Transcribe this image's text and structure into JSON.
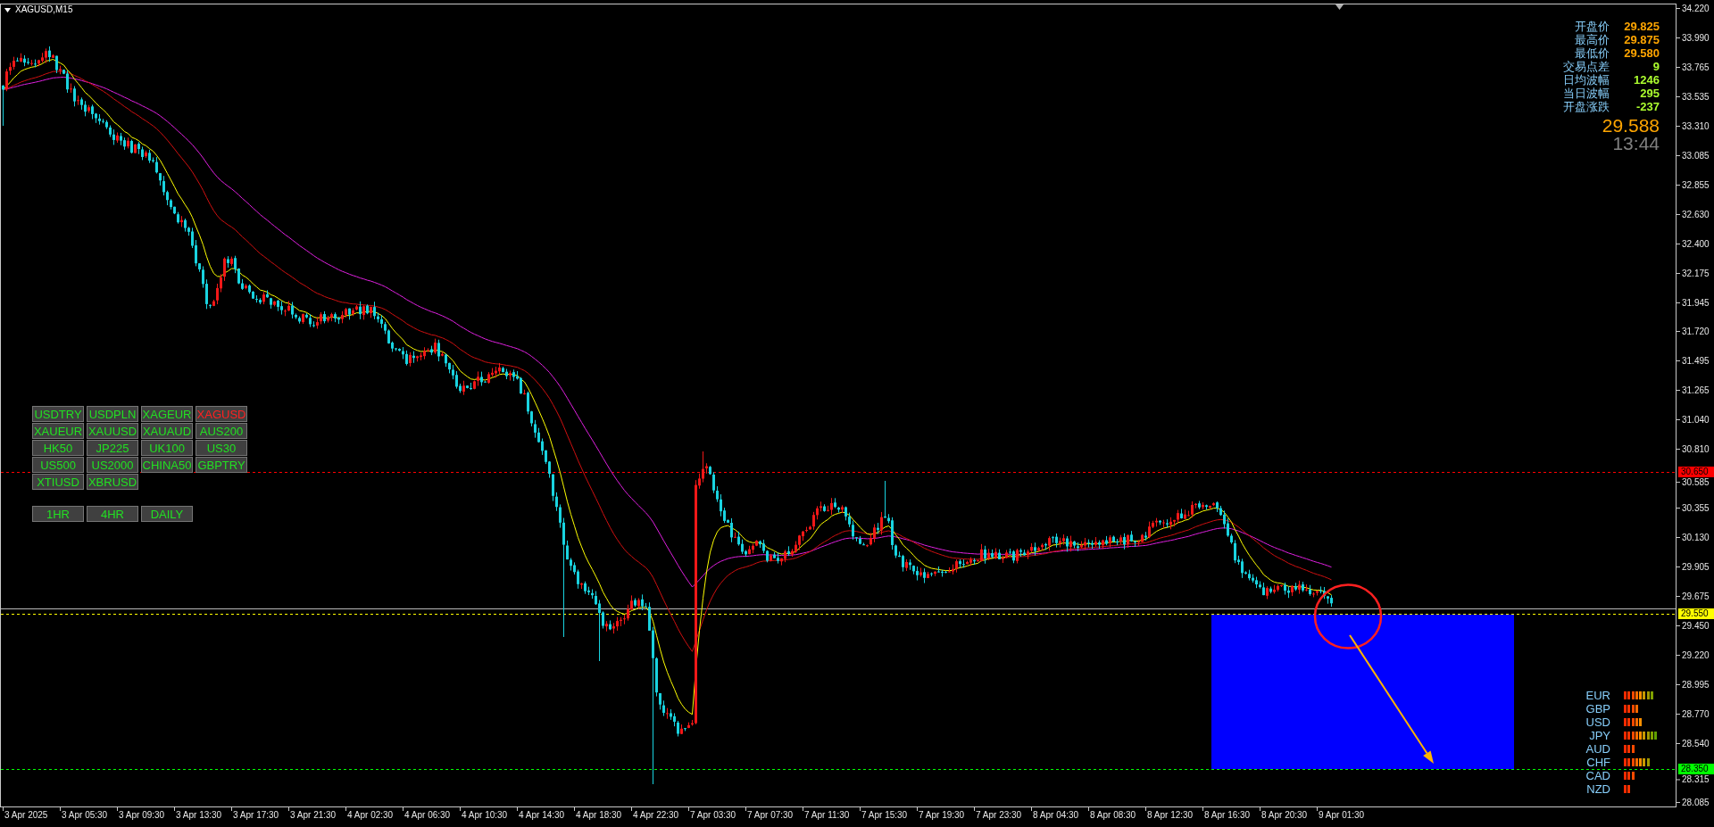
{
  "chart": {
    "title": "XAGUSD,M15"
  },
  "quote_panel": {
    "stats": [
      {
        "label": "开盘价",
        "value": "29.825",
        "color": "#ffa500"
      },
      {
        "label": "最高价",
        "value": "29.875",
        "color": "#ffa500"
      },
      {
        "label": "最低价",
        "value": "29.580",
        "color": "#ffa500"
      },
      {
        "label": "交易点差",
        "value": "9",
        "color": "#adff2f"
      },
      {
        "label": "日均波幅",
        "value": "1246",
        "color": "#adff2f"
      },
      {
        "label": "当日波幅",
        "value": "295",
        "color": "#adff2f"
      },
      {
        "label": "开盘涨跌",
        "value": "-237",
        "color": "#adff2f"
      }
    ],
    "price": "29.588",
    "countdown": "13:44"
  },
  "symbol_buttons": [
    {
      "label": "USDTRY",
      "selected": false
    },
    {
      "label": "USDPLN",
      "selected": false
    },
    {
      "label": "XAGEUR",
      "selected": false
    },
    {
      "label": "XAGUSD",
      "selected": true
    },
    {
      "label": "XAUEUR",
      "selected": false
    },
    {
      "label": "XAUUSD",
      "selected": false
    },
    {
      "label": "XAUAUD",
      "selected": false
    },
    {
      "label": "AUS200",
      "selected": false
    },
    {
      "label": "HK50",
      "selected": false
    },
    {
      "label": "JP225",
      "selected": false
    },
    {
      "label": "UK100",
      "selected": false
    },
    {
      "label": "US30",
      "selected": false
    },
    {
      "label": "US500",
      "selected": false
    },
    {
      "label": "US2000",
      "selected": false
    },
    {
      "label": "CHINA50",
      "selected": false
    },
    {
      "label": "GBPTRY",
      "selected": false
    },
    {
      "label": "XTIUSD",
      "selected": false
    },
    {
      "label": "XBRUSD",
      "selected": false
    }
  ],
  "timeframe_buttons": [
    {
      "label": "1HR",
      "selected": false
    },
    {
      "label": "4HR",
      "selected": false
    },
    {
      "label": "DAILY",
      "selected": false
    }
  ],
  "currency_strength": [
    {
      "currency": "EUR",
      "segments": [
        {
          "color": "#ff2a00"
        },
        {
          "color": "#ff3300"
        },
        {
          "color": "#ff4a00"
        },
        {
          "color": "#ff6a00"
        },
        {
          "color": "#ff9000"
        },
        {
          "color": "#c89a00"
        },
        {
          "color": "#a09a00"
        },
        {
          "color": "#80a000"
        }
      ]
    },
    {
      "currency": "GBP",
      "segments": [
        {
          "color": "#ff2a00"
        },
        {
          "color": "#ff3300"
        },
        {
          "color": "#ff4a00"
        },
        {
          "color": "#ff6a00"
        }
      ]
    },
    {
      "currency": "USD",
      "segments": [
        {
          "color": "#ff2a00"
        },
        {
          "color": "#ff3300"
        },
        {
          "color": "#ff4a00"
        },
        {
          "color": "#ff6a00"
        },
        {
          "color": "#ff9000"
        }
      ]
    },
    {
      "currency": "JPY",
      "segments": [
        {
          "color": "#ff2a00"
        },
        {
          "color": "#ff3300"
        },
        {
          "color": "#ff4a00"
        },
        {
          "color": "#ff6a00"
        },
        {
          "color": "#ff9000"
        },
        {
          "color": "#c89a00"
        },
        {
          "color": "#a09a00"
        },
        {
          "color": "#80a000"
        },
        {
          "color": "#60a000"
        }
      ]
    },
    {
      "currency": "AUD",
      "segments": [
        {
          "color": "#ff2a00"
        },
        {
          "color": "#ff3300"
        },
        {
          "color": "#ff4a00"
        }
      ]
    },
    {
      "currency": "CHF",
      "segments": [
        {
          "color": "#ff2a00"
        },
        {
          "color": "#ff3300"
        },
        {
          "color": "#ff4a00"
        },
        {
          "color": "#ff6a00"
        },
        {
          "color": "#ff9000"
        },
        {
          "color": "#c89a00"
        },
        {
          "color": "#a09a00"
        }
      ]
    },
    {
      "currency": "CAD",
      "segments": [
        {
          "color": "#ff2a00"
        },
        {
          "color": "#ff3300"
        },
        {
          "color": "#ff4a00"
        }
      ]
    },
    {
      "currency": "NZD",
      "segments": [
        {
          "color": "#ff2a00"
        },
        {
          "color": "#ff3300"
        }
      ]
    }
  ],
  "price_levels": [
    {
      "label": "30.650",
      "color": "#ff0000"
    },
    {
      "label": "29.550",
      "color": "#ffff00"
    },
    {
      "label": "28.350",
      "color": "#00ff00"
    }
  ],
  "price_axis": [
    "34.220",
    "33.990",
    "33.765",
    "33.535",
    "33.310",
    "33.085",
    "32.855",
    "32.630",
    "32.400",
    "32.175",
    "31.945",
    "31.720",
    "31.495",
    "31.265",
    "31.040",
    "30.810",
    "30.585",
    "30.355",
    "30.130",
    "29.905",
    "29.675",
    "29.450",
    "29.220",
    "28.995",
    "28.770",
    "28.540",
    "28.315",
    "28.085"
  ],
  "time_axis": [
    "3 Apr 2025",
    "3 Apr 05:30",
    "3 Apr 09:30",
    "3 Apr 13:30",
    "3 Apr 17:30",
    "3 Apr 21:30",
    "4 Apr 02:30",
    "4 Apr 06:30",
    "4 Apr 10:30",
    "4 Apr 14:30",
    "4 Apr 18:30",
    "4 Apr 22:30",
    "7 Apr 03:30",
    "7 Apr 07:30",
    "7 Apr 11:30",
    "7 Apr 15:30",
    "7 Apr 19:30",
    "7 Apr 23:30",
    "8 Apr 04:30",
    "8 Apr 08:30",
    "8 Apr 12:30",
    "8 Apr 16:30",
    "8 Apr 20:30",
    "9 Apr 01:30"
  ]
}
